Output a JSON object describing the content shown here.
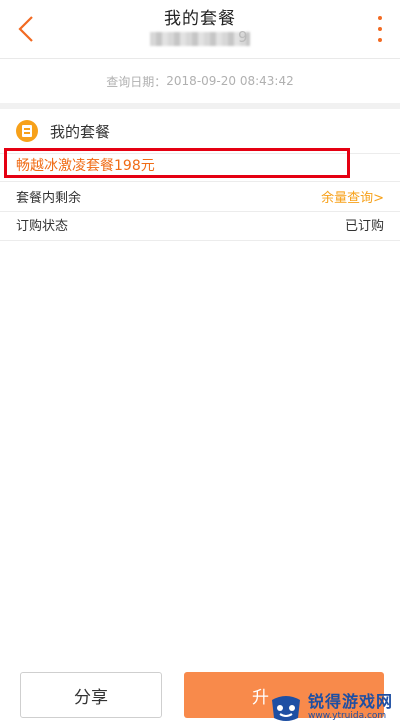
{
  "header": {
    "title": "我的套餐",
    "subtitle_suffix": "9"
  },
  "query": {
    "label": "查询日期：",
    "datetime": "2018-09-20 08:43:42"
  },
  "package_section": {
    "title": "我的套餐",
    "plan_name": "畅越冰激凌套餐198元"
  },
  "rows": [
    {
      "label": "套餐内剩余",
      "value": "余量查询>"
    },
    {
      "label": "订购状态",
      "value": "已订购"
    }
  ],
  "buttons": {
    "share": "分享",
    "upgrade": "升"
  },
  "watermark": {
    "name": "锐得游戏网",
    "url": "www.ytruida.com"
  },
  "colors": {
    "accent": "#f26a22",
    "highlight_border": "#e50012",
    "plan_text": "#f06c16",
    "link": "#f7a11a",
    "upgrade_button": "#f88a4b"
  }
}
